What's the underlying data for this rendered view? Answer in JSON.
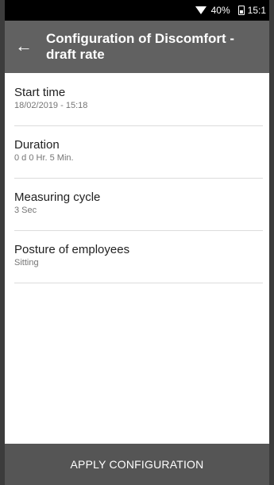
{
  "status_bar": {
    "wifi_icon": "wifi-icon",
    "battery_percent": "40%",
    "battery_icon": "battery-icon",
    "time": "15:1"
  },
  "app_bar": {
    "back_icon": "arrow-left-icon",
    "title": "Configuration of Discomfort - draft rate"
  },
  "settings": [
    {
      "label": "Start time",
      "value": "18/02/2019 - 15:18"
    },
    {
      "label": "Duration",
      "value": "0 d 0 Hr. 5 Min."
    },
    {
      "label": "Measuring cycle",
      "value": "3 Sec"
    },
    {
      "label": "Posture of employees",
      "value": "Sitting"
    }
  ],
  "footer": {
    "apply_label": "APPLY CONFIGURATION"
  },
  "colors": {
    "status_bar": "#000000",
    "app_bar": "#616161",
    "footer_button": "#555555",
    "divider": "#dcdcdc"
  }
}
